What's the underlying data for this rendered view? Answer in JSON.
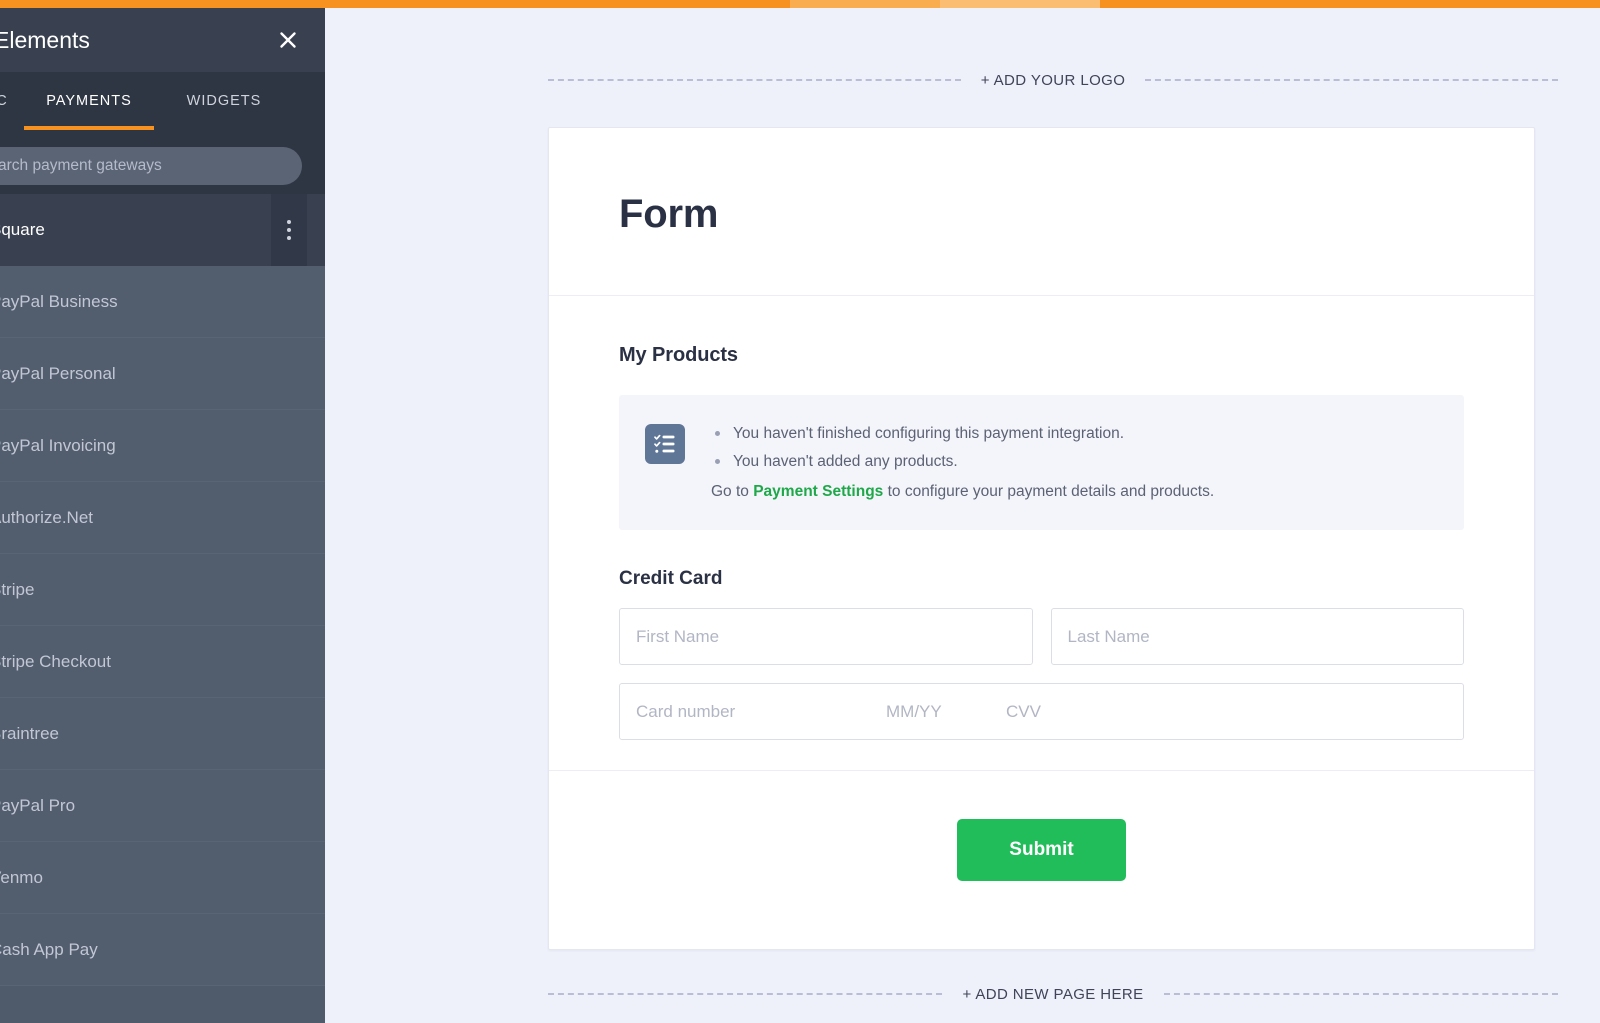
{
  "theme": {
    "accent_orange": "#f79220",
    "panel_dark": "#39404f",
    "panel_body": "#525d6e",
    "submit_green": "#22bd5b",
    "link_green": "#1fa84a",
    "canvas_bg": "#eef0fa"
  },
  "panel": {
    "title": "Elements",
    "close_icon": "close-icon",
    "tabs": [
      {
        "label": "C",
        "active": false,
        "name": "tab-basic"
      },
      {
        "label": "PAYMENTS",
        "active": true,
        "name": "tab-payments"
      },
      {
        "label": "WIDGETS",
        "active": false,
        "name": "tab-widgets"
      }
    ],
    "search": {
      "placeholder": "arch payment gateways",
      "value": ""
    },
    "gateways": [
      {
        "label": "Square",
        "selected": true
      },
      {
        "label": "PayPal Business",
        "selected": false
      },
      {
        "label": "PayPal Personal",
        "selected": false
      },
      {
        "label": "PayPal Invoicing",
        "selected": false
      },
      {
        "label": "Authorize.Net",
        "selected": false
      },
      {
        "label": "Stripe",
        "selected": false
      },
      {
        "label": "Stripe Checkout",
        "selected": false
      },
      {
        "label": "Braintree",
        "selected": false
      },
      {
        "label": "PayPal Pro",
        "selected": false
      },
      {
        "label": "Venmo",
        "selected": false
      },
      {
        "label": "Cash App Pay",
        "selected": false
      }
    ]
  },
  "canvas": {
    "add_logo_label": "+ ADD YOUR LOGO",
    "add_page_label": "+ ADD NEW PAGE HERE"
  },
  "form": {
    "title": "Form",
    "products": {
      "heading": "My Products",
      "icon": "checklist-icon",
      "bullets": [
        "You haven't finished configuring this payment integration.",
        "You haven't added any products."
      ],
      "cta_prefix": "Go to ",
      "cta_link": "Payment Settings",
      "cta_suffix": " to configure your payment details and products."
    },
    "credit_card": {
      "heading": "Credit Card",
      "first_name_placeholder": "First Name",
      "last_name_placeholder": "Last Name",
      "card_number_placeholder": "Card number",
      "expiry_placeholder": "MM/YY",
      "cvv_placeholder": "CVV"
    },
    "submit_label": "Submit"
  }
}
